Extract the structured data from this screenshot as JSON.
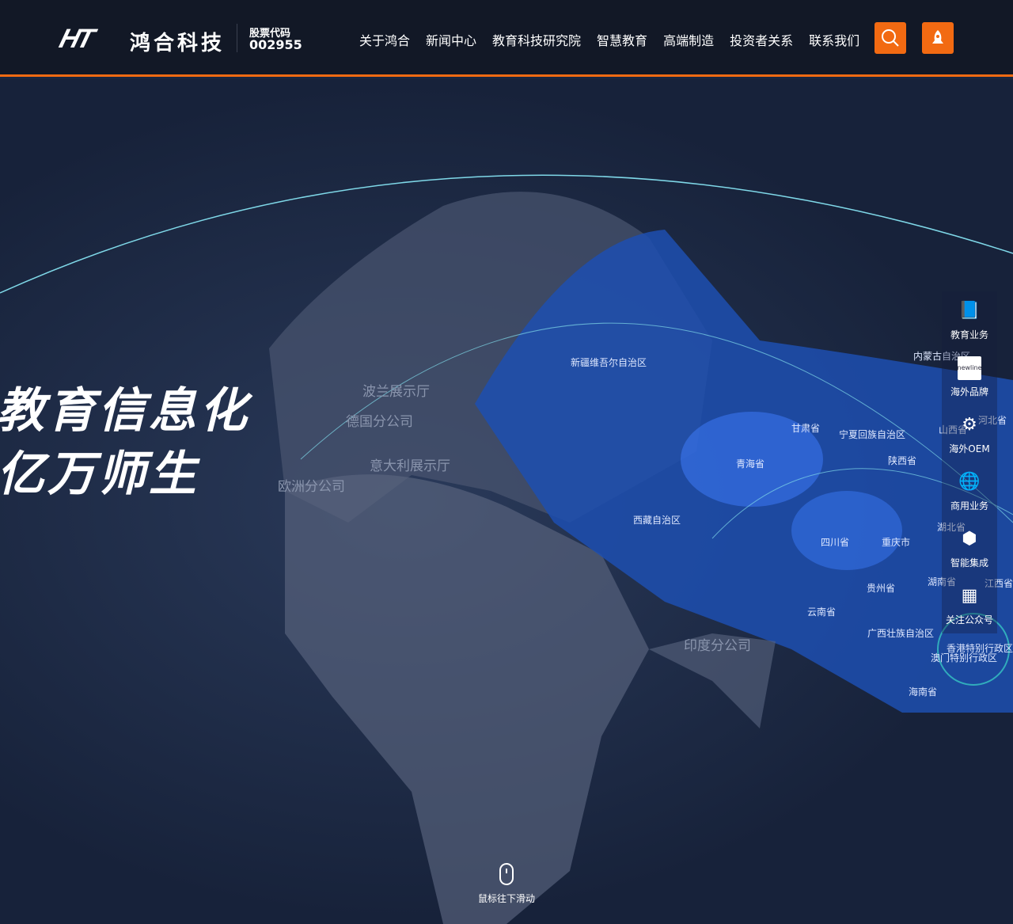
{
  "header": {
    "logo_mark": "HT",
    "company": "鸿合科技",
    "stock_label": "股票代码",
    "stock_code": "002955",
    "nav": [
      "关于鸿合",
      "新闻中心",
      "教育科技研究院",
      "智慧教育",
      "高端制造",
      "投资者关系",
      "联系我们"
    ]
  },
  "hero": {
    "line1": "教育信息化",
    "line2": "亿万师生"
  },
  "map_labels": {
    "poland": "波兰展示厅",
    "germany": "德国分公司",
    "italy": "意大利展示厅",
    "europe": "欧洲分公司",
    "india": "印度分公司"
  },
  "provinces": [
    "新疆维吾尔自治区",
    "西藏自治区",
    "青海省",
    "甘肃省",
    "四川省",
    "宁夏回族自治区",
    "陕西省",
    "内蒙古自治区",
    "山西省",
    "河北省",
    "重庆市",
    "湖北省",
    "贵州省",
    "湖南省",
    "江西省",
    "云南省",
    "广西壮族自治区",
    "香港特别行政区",
    "澳门特别行政区",
    "海南省"
  ],
  "sidebar": [
    {
      "label": "教育业务",
      "icon": "book-icon"
    },
    {
      "label": "海外品牌",
      "icon": "newline-icon",
      "logo_text": "newline"
    },
    {
      "label": "海外OEM",
      "icon": "gear-hand-icon"
    },
    {
      "label": "商用业务",
      "icon": "globe-icon"
    },
    {
      "label": "智能集成",
      "icon": "cube-icon"
    },
    {
      "label": "关注公众号",
      "icon": "qrcode-icon"
    }
  ],
  "scroll_hint": "鼠标往下滑动",
  "colors": {
    "accent": "#f26a12",
    "header_bg": "#121826"
  }
}
